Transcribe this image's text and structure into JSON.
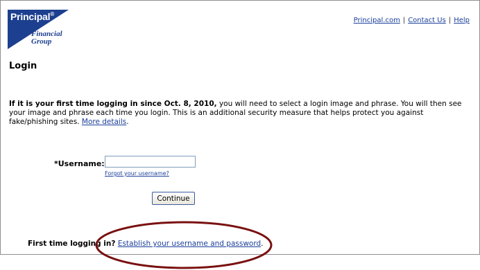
{
  "brand": {
    "name": "Principal",
    "registered": "®",
    "subline1": "Financial",
    "subline2": "Group",
    "color": "#1c3f8f"
  },
  "toplinks": {
    "principal": "Principal.com",
    "contact": "Contact Us",
    "help": "Help",
    "separator": "|"
  },
  "page_title": "Login",
  "intro": {
    "bold": "If it is your first time logging in since Oct. 8, 2010,",
    "text": " you will need to select a login image and phrase. You will then see your image and phrase each time you login. This is an additional security measure that helps protect you against fake/phishing sites. ",
    "link": "More details",
    "end": "."
  },
  "form": {
    "username_label": "*Username:",
    "username_value": "",
    "forgot_link": "Forgot your username?",
    "continue_label": "Continue"
  },
  "first_time": {
    "label": "First time logging in?",
    "link": "Establish your username and password",
    "end": "."
  },
  "annotation": {
    "circle_color": "#7a1010"
  }
}
